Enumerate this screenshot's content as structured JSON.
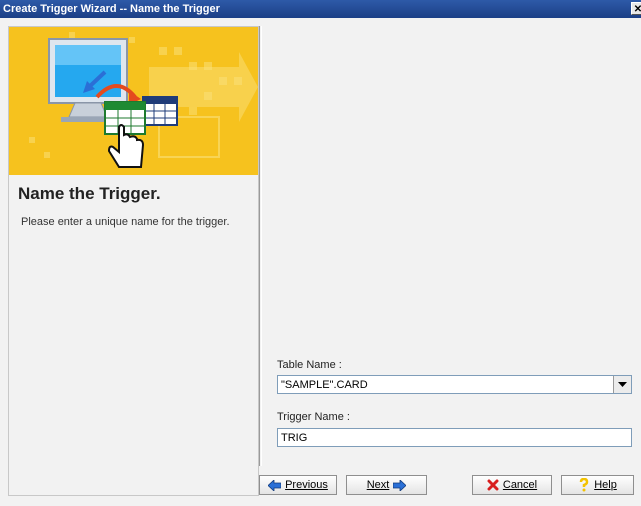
{
  "window": {
    "title": "Create Trigger Wizard -- Name the Trigger",
    "close_glyph": "✕"
  },
  "step": {
    "title": "Name the Trigger.",
    "description": "Please enter a unique name for the trigger."
  },
  "form": {
    "table_label": "Table Name :",
    "table_value": "\"SAMPLE\".CARD",
    "trigger_label": "Trigger Name :",
    "trigger_value": "TRIG"
  },
  "buttons": {
    "previous": "Previous",
    "next": "Next",
    "cancel": "Cancel",
    "help": "Help"
  },
  "icons": {
    "previous": "arrow-left-icon",
    "next": "arrow-right-icon",
    "cancel": "red-x-icon",
    "help": "question-mark-icon",
    "dropdown": "chevron-down-icon"
  },
  "colors": {
    "title_bar": "#1b3f86",
    "banner": "#f6c21e",
    "arrow_blue": "#2a6fd6",
    "cancel_red": "#d81e1e",
    "help_yellow": "#f3c200"
  }
}
